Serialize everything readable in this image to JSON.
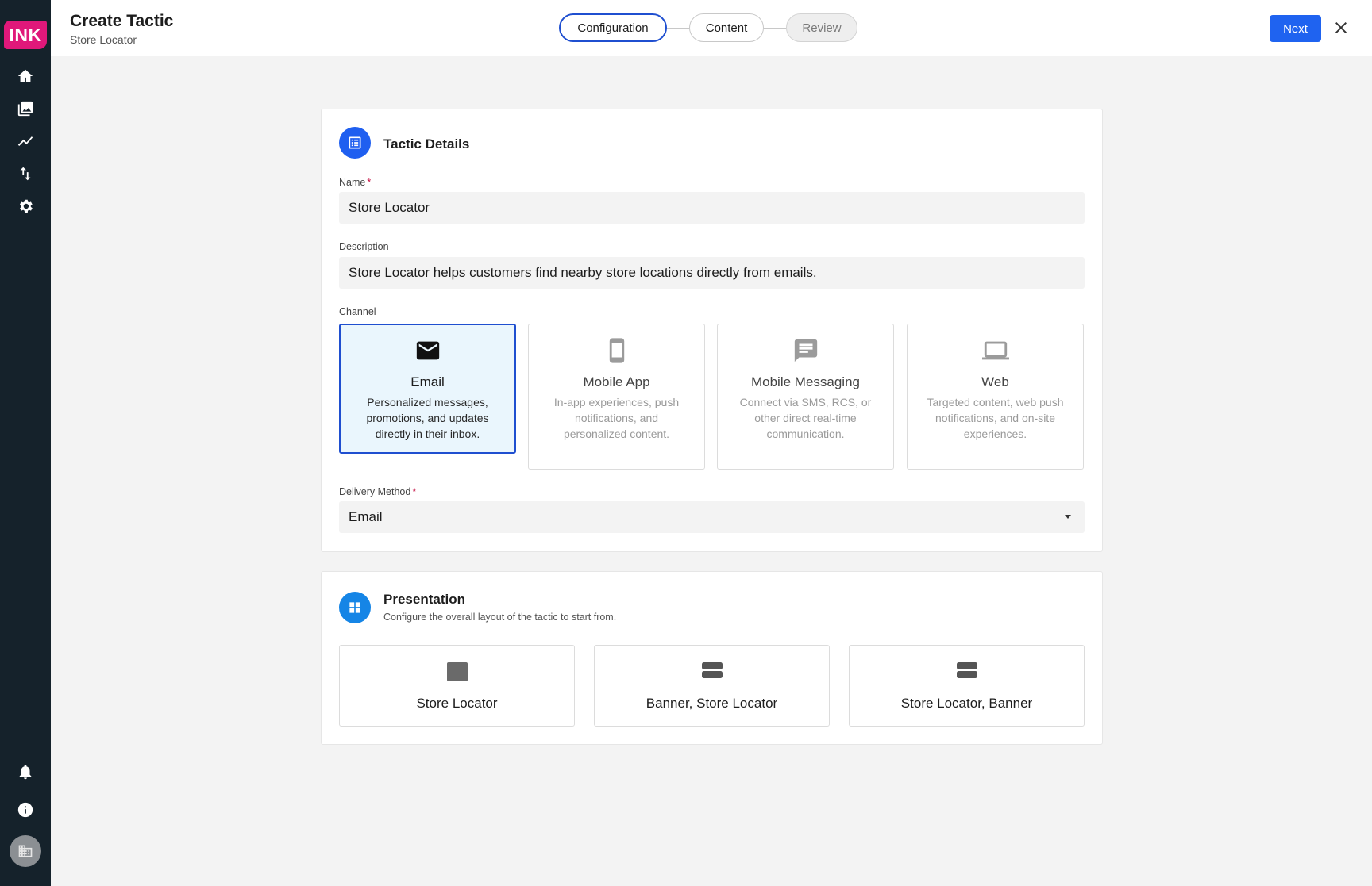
{
  "app": {
    "logo_text": "INK",
    "brand_color": "#e0187a",
    "accent_color": "#1f63f0"
  },
  "sidebar": {
    "nav": [
      {
        "icon": "home-icon"
      },
      {
        "icon": "gallery-icon"
      },
      {
        "icon": "trend-icon"
      },
      {
        "icon": "sort-icon"
      },
      {
        "icon": "gear-icon"
      }
    ],
    "bottom": [
      {
        "icon": "bell-icon"
      },
      {
        "icon": "info-icon"
      },
      {
        "icon": "building-icon"
      }
    ]
  },
  "header": {
    "title": "Create Tactic",
    "subtitle": "Store Locator",
    "steps": [
      {
        "label": "Configuration",
        "state": "active"
      },
      {
        "label": "Content",
        "state": "default"
      },
      {
        "label": "Review",
        "state": "disabled"
      }
    ],
    "next_label": "Next",
    "close_icon": "close-icon"
  },
  "tactic_details": {
    "title": "Tactic Details",
    "icon": "list-icon",
    "name_label": "Name",
    "name_required": "*",
    "name_value": "Store Locator",
    "description_label": "Description",
    "description_value": "Store Locator helps customers find nearby store locations directly from emails.",
    "channel_label": "Channel",
    "channels": [
      {
        "title": "Email",
        "desc": "Personalized messages, promotions, and updates directly in their inbox.",
        "icon": "mail-icon",
        "selected": true
      },
      {
        "title": "Mobile App",
        "desc": "In-app experiences, push notifications, and personalized content.",
        "icon": "phone-icon",
        "selected": false
      },
      {
        "title": "Mobile Messaging",
        "desc": "Connect via SMS, RCS, or other direct real-time communication.",
        "icon": "chat-icon",
        "selected": false
      },
      {
        "title": "Web",
        "desc": "Targeted content, web push notifications, and on-site experiences.",
        "icon": "laptop-icon",
        "selected": false
      }
    ],
    "delivery_label": "Delivery Method",
    "delivery_required": "*",
    "delivery_value": "Email"
  },
  "presentation": {
    "title": "Presentation",
    "icon": "grid-icon",
    "description": "Configure the overall layout of the tactic to start from.",
    "options": [
      {
        "label": "Store Locator",
        "icon": "single-block-icon"
      },
      {
        "label": "Banner, Store Locator",
        "icon": "two-rows-icon"
      },
      {
        "label": "Store Locator, Banner",
        "icon": "two-rows-icon"
      }
    ]
  }
}
